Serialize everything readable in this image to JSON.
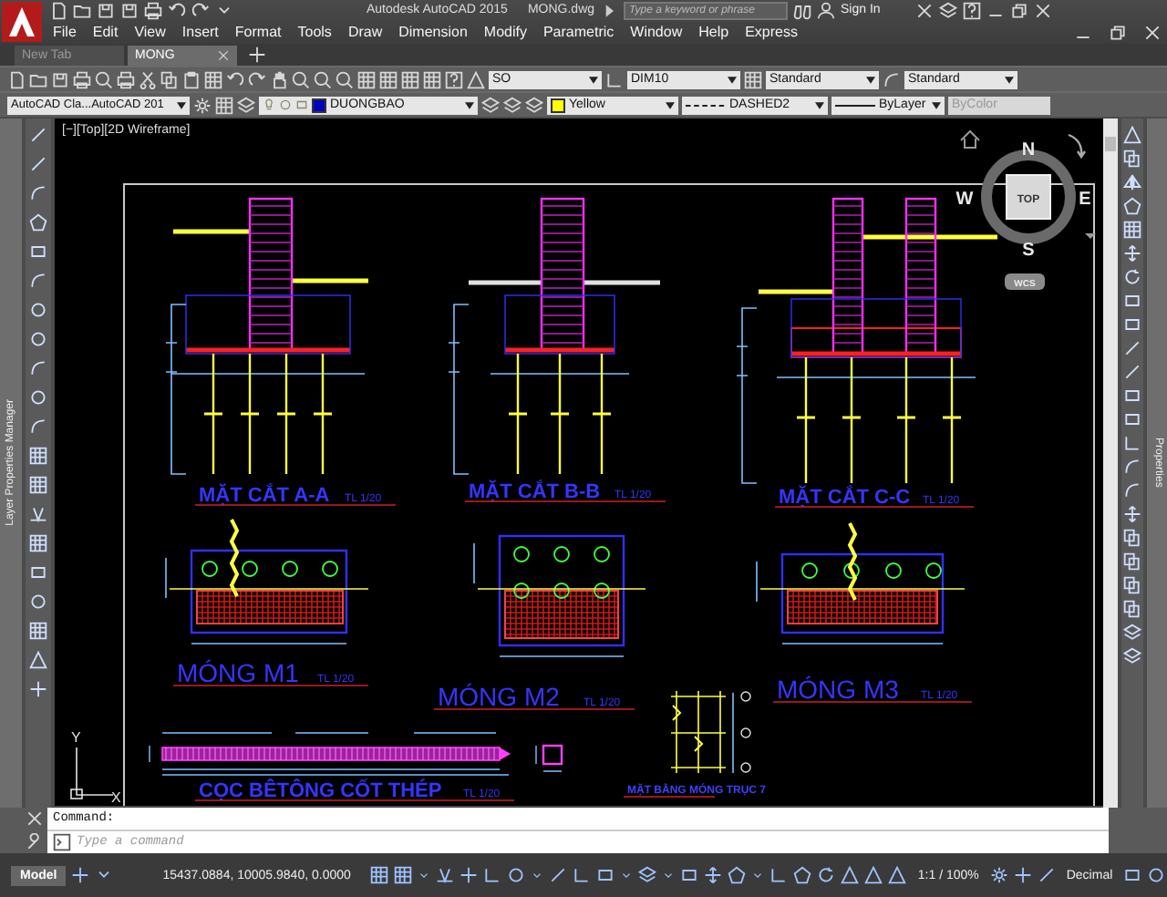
{
  "app": {
    "title": "Autodesk AutoCAD 2015",
    "file": "MONG.dwg",
    "search": {
      "placeholder": "Type a keyword or phrase"
    },
    "sign_in": "Sign In"
  },
  "menu": [
    "File",
    "Edit",
    "View",
    "Insert",
    "Format",
    "Tools",
    "Draw",
    "Dimension",
    "Modify",
    "Parametric",
    "Window",
    "Help",
    "Express"
  ],
  "tabs": [
    {
      "label": "New Tab",
      "selected": false
    },
    {
      "label": "MONG",
      "selected": true
    }
  ],
  "styles_toolbar": {
    "text_style": "SO",
    "dimension_style": "DIM10",
    "table_style": "Standard",
    "multileader_style": "Standard"
  },
  "properties_toolbar": {
    "workspace": "AutoCAD Cla...AutoCAD 201",
    "layer": "DUONGBAO",
    "color_name": "Yellow",
    "linetype": "DASHED2",
    "lineweight": "ByLayer",
    "plot_style": {
      "value": "ByColor",
      "disabled": true
    }
  },
  "palettes": {
    "left": "Layer Properties Manager",
    "right": "Properties"
  },
  "viewport": {
    "label": "[−][Top][2D Wireframe]"
  },
  "viewcube": {
    "north": "N",
    "south": "S",
    "east": "E",
    "west": "W",
    "face": "TOP",
    "ucs": "WCS"
  },
  "drawing": {
    "titles": [
      {
        "kind": "section",
        "text": "MẶT CẮT A-A",
        "scale": "TL 1/20"
      },
      {
        "kind": "section",
        "text": "MẶT CẮT B-B",
        "scale": "TL 1/20"
      },
      {
        "kind": "section",
        "text": "MẶT CẮT C-C",
        "scale": "TL 1/20"
      },
      {
        "kind": "foundation",
        "text": "MÓNG M1",
        "scale": "TL 1/20"
      },
      {
        "kind": "foundation",
        "text": "MÓNG M2",
        "scale": "TL 1/20"
      },
      {
        "kind": "foundation",
        "text": "MÓNG M3",
        "scale": "TL 1/20"
      },
      {
        "kind": "section",
        "text": "CỌC BÊTÔNG CỐT THÉP",
        "scale": "TL 1/20"
      },
      {
        "kind": "plan",
        "text": "MẶT BẰNG MÓNG TRỤC 7"
      }
    ]
  },
  "ucs_icon": {
    "x": "X",
    "y": "Y"
  },
  "command_line": {
    "history": "Command:",
    "placeholder": "Type a command"
  },
  "status_bar": {
    "layout_tab": "Model",
    "coordinates": "15437.0884, 10005.9840, 0.0000",
    "annotation_scale": "1:1 / 100%",
    "units": "Decimal"
  }
}
